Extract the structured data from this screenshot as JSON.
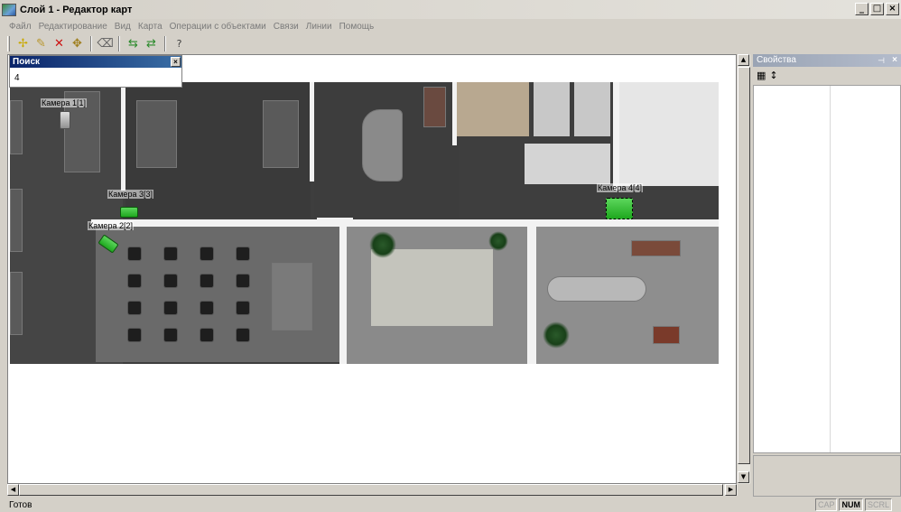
{
  "window": {
    "title": "Слой 1 - Редактор карт",
    "controls": [
      "_",
      "□",
      "×"
    ]
  },
  "menu": [
    "Файл",
    "Редактирование",
    "Вид",
    "Карта",
    "Операции с объектами",
    "Связи",
    "Линии",
    "Помощь"
  ],
  "toolbar": {
    "buttons": [
      {
        "name": "add-point-icon",
        "glyph": "✢"
      },
      {
        "name": "pencil-icon",
        "glyph": "✎"
      },
      {
        "name": "delete-icon",
        "glyph": "✕"
      },
      {
        "name": "move-icon",
        "glyph": "✥"
      },
      {
        "name": "eraser-icon",
        "glyph": "⌫"
      },
      {
        "name": "undo-icon",
        "glyph": "⇆"
      },
      {
        "name": "redo-icon",
        "glyph": "⇄"
      },
      {
        "name": "help-icon",
        "glyph": "?"
      }
    ]
  },
  "search": {
    "title": "Поиск",
    "value": "4",
    "close": "×"
  },
  "cameras": [
    {
      "label": "Камера 1[1]"
    },
    {
      "label": "Камера 3[3]"
    },
    {
      "label": "Камера 2[2]"
    },
    {
      "label": "Камера 4[4]"
    }
  ],
  "properties": {
    "title": "Свойства",
    "pin": "⊣",
    "close": "×",
    "tools": [
      "▦",
      "↕"
    ]
  },
  "status": {
    "text": "Готов",
    "indicators": [
      {
        "label": "CAP",
        "active": false
      },
      {
        "label": "NUM",
        "active": true
      },
      {
        "label": "SCRL",
        "active": false
      }
    ]
  },
  "colors": {
    "camera_green": "#2ec42e",
    "title_active": "#0a246a",
    "floor_dark": "#3e3e3e"
  }
}
